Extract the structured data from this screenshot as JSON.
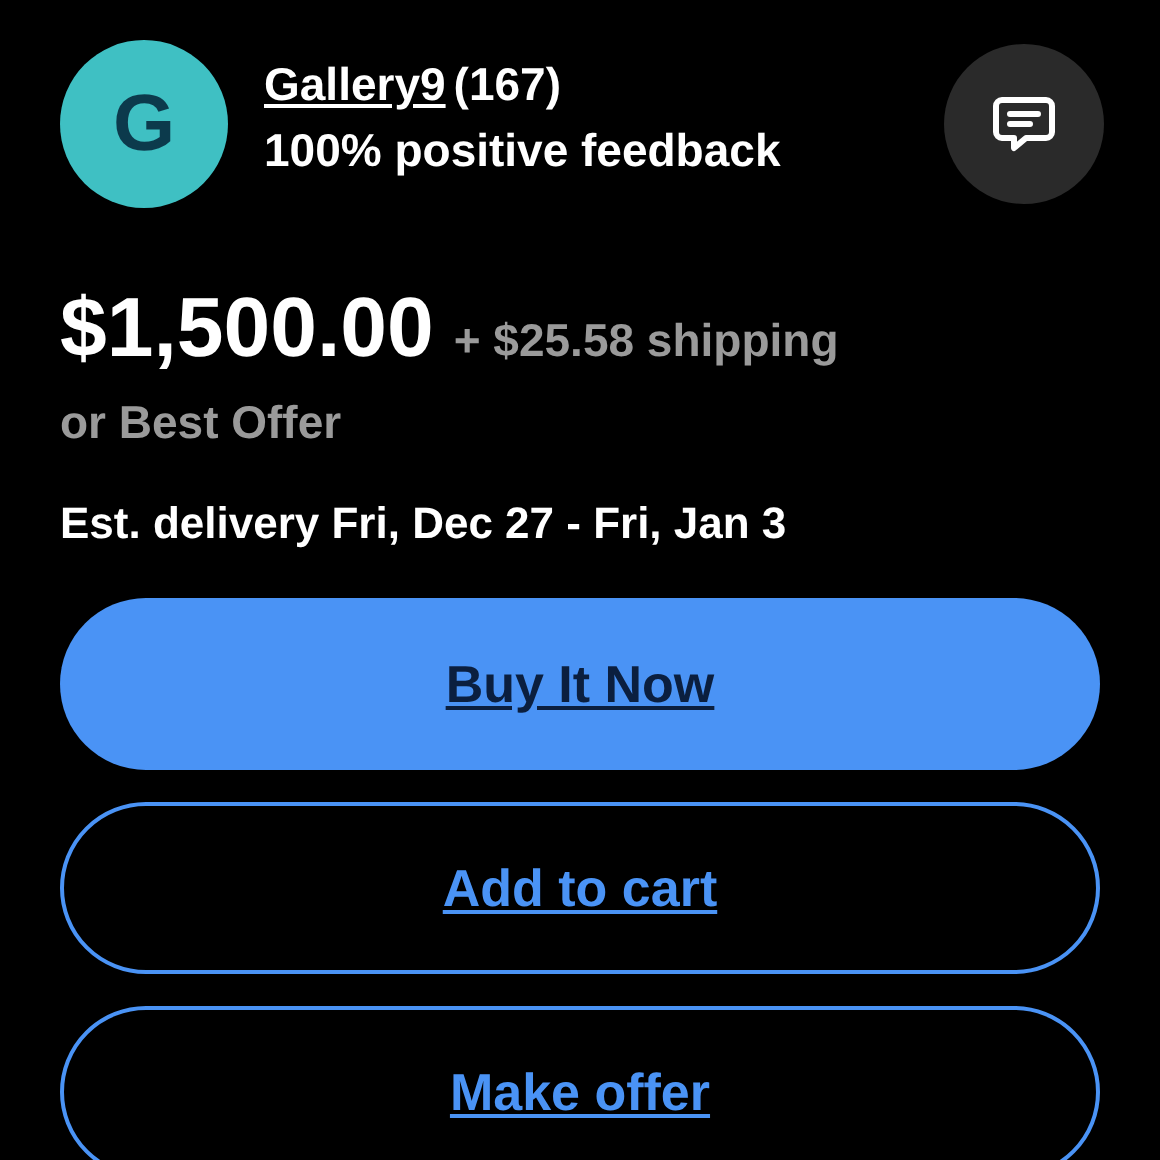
{
  "seller": {
    "avatar_letter": "G",
    "name": "Gallery9",
    "count": "(167)",
    "feedback": "100% positive feedback"
  },
  "price": "$1,500.00",
  "shipping": "+ $25.58 shipping",
  "offer_note": "or Best Offer",
  "delivery": "Est. delivery Fri, Dec 27 - Fri, Jan 3",
  "buttons": [
    {
      "label": "Buy It Now",
      "kind": "primary"
    },
    {
      "label": "Add to cart",
      "kind": "outline"
    },
    {
      "label": "Make offer",
      "kind": "outline"
    }
  ]
}
